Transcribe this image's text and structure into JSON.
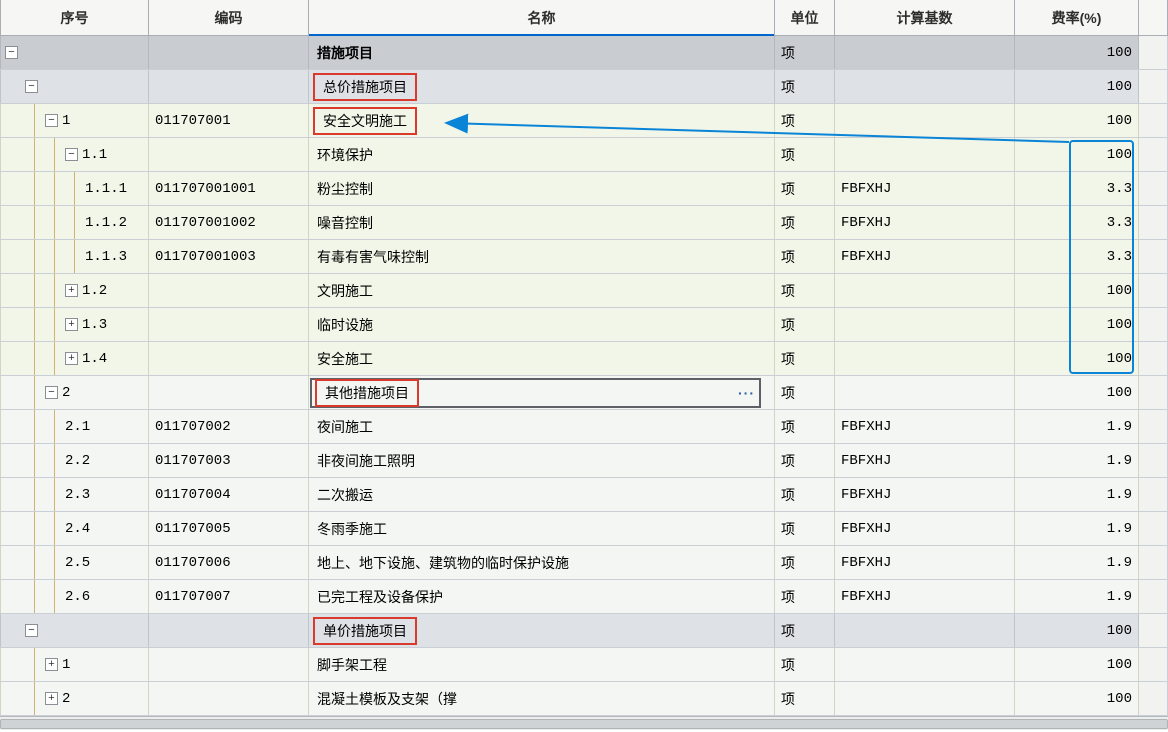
{
  "columns": {
    "seq": "序号",
    "code": "编码",
    "name": "名称",
    "unit": "单位",
    "base": "计算基数",
    "rate": "费率(%)"
  },
  "rows": [
    {
      "id": "r0",
      "depth": 0,
      "expander": "minus",
      "seq": "",
      "code": "",
      "name": "措施项目",
      "name_bold": true,
      "unit": "项",
      "base": "",
      "rate": "100",
      "bg": "darkgrey",
      "highlight": "none"
    },
    {
      "id": "r1",
      "depth": 1,
      "expander": "minus",
      "seq": "",
      "code": "",
      "name": "总价措施项目",
      "name_bold": false,
      "unit": "项",
      "base": "",
      "rate": "100",
      "bg": "grey",
      "highlight": "redbox"
    },
    {
      "id": "r2",
      "depth": 2,
      "expander": "minus",
      "seq": "1",
      "code": "011707001",
      "name": "安全文明施工",
      "name_bold": false,
      "unit": "项",
      "base": "",
      "rate": "100",
      "bg": "green",
      "highlight": "redbox"
    },
    {
      "id": "r3",
      "depth": 3,
      "expander": "minus",
      "seq": "1.1",
      "code": "",
      "name": "环境保护",
      "name_bold": false,
      "unit": "项",
      "base": "",
      "rate": "100",
      "bg": "green",
      "highlight": "none"
    },
    {
      "id": "r4",
      "depth": 4,
      "expander": "none",
      "seq": "1.1.1",
      "code": "011707001001",
      "name": "粉尘控制",
      "name_bold": false,
      "unit": "项",
      "base": "FBFXHJ",
      "rate": "3.3",
      "bg": "green",
      "highlight": "none"
    },
    {
      "id": "r5",
      "depth": 4,
      "expander": "none",
      "seq": "1.1.2",
      "code": "011707001002",
      "name": "噪音控制",
      "name_bold": false,
      "unit": "项",
      "base": "FBFXHJ",
      "rate": "3.3",
      "bg": "green",
      "highlight": "none"
    },
    {
      "id": "r6",
      "depth": 4,
      "expander": "none",
      "seq": "1.1.3",
      "code": "011707001003",
      "name": "有毒有害气味控制",
      "name_bold": false,
      "unit": "项",
      "base": "FBFXHJ",
      "rate": "3.3",
      "bg": "green",
      "highlight": "none"
    },
    {
      "id": "r7",
      "depth": 3,
      "expander": "plus",
      "seq": "1.2",
      "code": "",
      "name": "文明施工",
      "name_bold": false,
      "unit": "项",
      "base": "",
      "rate": "100",
      "bg": "green",
      "highlight": "none"
    },
    {
      "id": "r8",
      "depth": 3,
      "expander": "plus",
      "seq": "1.3",
      "code": "",
      "name": "临时设施",
      "name_bold": false,
      "unit": "项",
      "base": "",
      "rate": "100",
      "bg": "green",
      "highlight": "none"
    },
    {
      "id": "r9",
      "depth": 3,
      "expander": "plus",
      "seq": "1.4",
      "code": "",
      "name": "安全施工",
      "name_bold": false,
      "unit": "项",
      "base": "",
      "rate": "100",
      "bg": "green",
      "highlight": "none"
    },
    {
      "id": "r10",
      "depth": 2,
      "expander": "minus",
      "seq": "2",
      "code": "",
      "name": "其他措施项目",
      "name_bold": false,
      "unit": "项",
      "base": "",
      "rate": "100",
      "bg": "white",
      "highlight": "redbox-selected"
    },
    {
      "id": "r11",
      "depth": 3,
      "expander": "none",
      "seq": "2.1",
      "code": "011707002",
      "name": "夜间施工",
      "name_bold": false,
      "unit": "项",
      "base": "FBFXHJ",
      "rate": "1.9",
      "bg": "white",
      "highlight": "none"
    },
    {
      "id": "r12",
      "depth": 3,
      "expander": "none",
      "seq": "2.2",
      "code": "011707003",
      "name": "非夜间施工照明",
      "name_bold": false,
      "unit": "项",
      "base": "FBFXHJ",
      "rate": "1.9",
      "bg": "white",
      "highlight": "none"
    },
    {
      "id": "r13",
      "depth": 3,
      "expander": "none",
      "seq": "2.3",
      "code": "011707004",
      "name": "二次搬运",
      "name_bold": false,
      "unit": "项",
      "base": "FBFXHJ",
      "rate": "1.9",
      "bg": "white",
      "highlight": "none"
    },
    {
      "id": "r14",
      "depth": 3,
      "expander": "none",
      "seq": "2.4",
      "code": "011707005",
      "name": "冬雨季施工",
      "name_bold": false,
      "unit": "项",
      "base": "FBFXHJ",
      "rate": "1.9",
      "bg": "white",
      "highlight": "none"
    },
    {
      "id": "r15",
      "depth": 3,
      "expander": "none",
      "seq": "2.5",
      "code": "011707006",
      "name": "地上、地下设施、建筑物的临时保护设施",
      "name_bold": false,
      "unit": "项",
      "base": "FBFXHJ",
      "rate": "1.9",
      "bg": "white",
      "highlight": "none"
    },
    {
      "id": "r16",
      "depth": 3,
      "expander": "none",
      "seq": "2.6",
      "code": "011707007",
      "name": "已完工程及设备保护",
      "name_bold": false,
      "unit": "项",
      "base": "FBFXHJ",
      "rate": "1.9",
      "bg": "white",
      "highlight": "none"
    },
    {
      "id": "r17",
      "depth": 1,
      "expander": "minus",
      "seq": "",
      "code": "",
      "name": "单价措施项目",
      "name_bold": false,
      "unit": "项",
      "base": "",
      "rate": "100",
      "bg": "grey",
      "highlight": "redbox"
    },
    {
      "id": "r18",
      "depth": 2,
      "expander": "plus",
      "seq": "1",
      "code": "",
      "name": "脚手架工程",
      "name_bold": false,
      "unit": "项",
      "base": "",
      "rate": "100",
      "bg": "white",
      "highlight": "none"
    },
    {
      "id": "r19",
      "depth": 2,
      "expander": "plus",
      "seq": "2",
      "code": "",
      "name": "混凝土模板及支架（撑",
      "name_bold": false,
      "unit": "项",
      "base": "",
      "rate": "100",
      "bg": "white",
      "highlight": "none"
    }
  ],
  "annotations": {
    "blue_rate_box": {
      "from_row": "r3",
      "to_row": "r9"
    },
    "blue_arrow": {
      "from_row_id": "r3",
      "to_row_id": "r2",
      "label": ""
    },
    "editor_dots": "···"
  }
}
